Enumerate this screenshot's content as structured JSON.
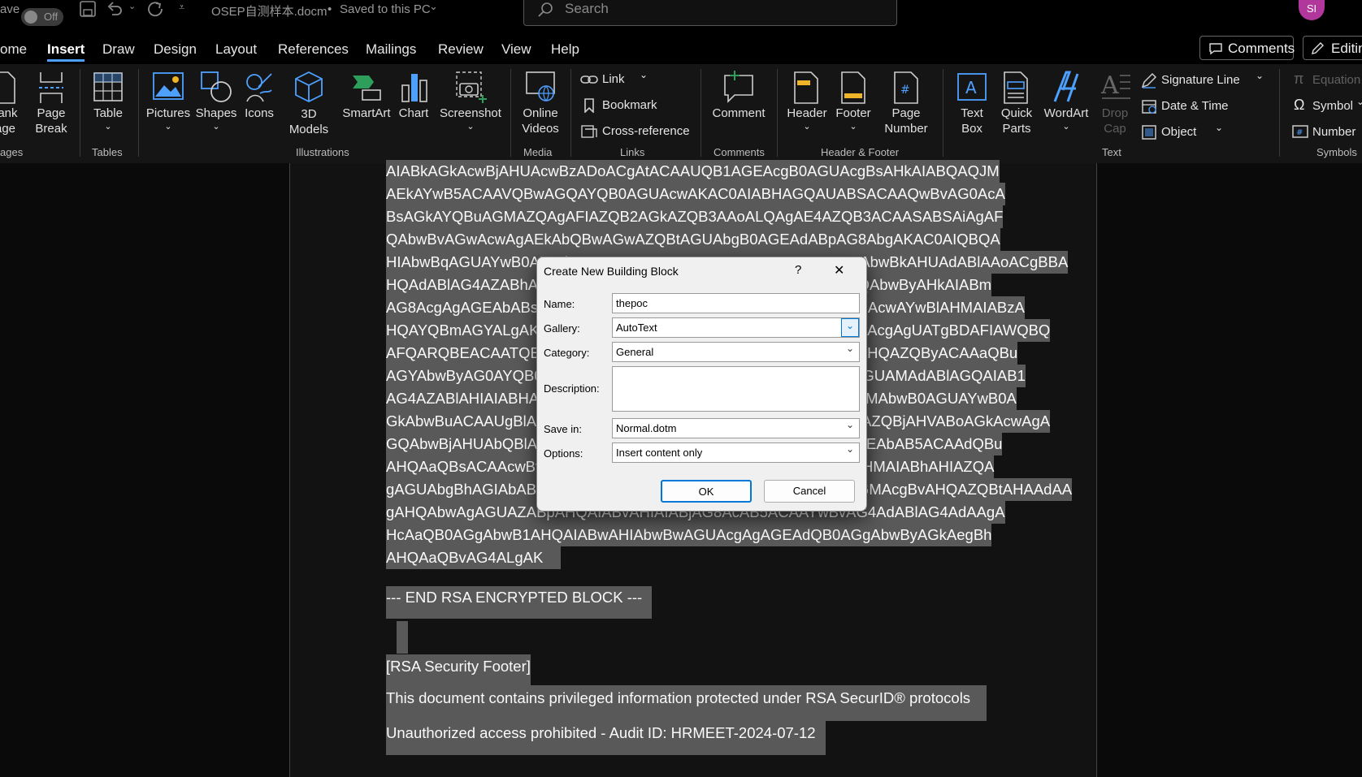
{
  "titlebar": {
    "autosave_label": "ave",
    "autosave_state": "Off",
    "doc_title": "OSEP自测样本.docm",
    "save_status": "Saved to this PC",
    "search_placeholder": "Search",
    "avatar_initials": "SI"
  },
  "menu": {
    "tabs": [
      "ome",
      "Insert",
      "Draw",
      "Design",
      "Layout",
      "References",
      "Mailings",
      "Review",
      "View",
      "Help"
    ],
    "active": "Insert",
    "comments_button": "Comments",
    "editing_button": "Editin"
  },
  "ribbon": {
    "pages": {
      "blank_line1": "lank",
      "blank_line2": "age",
      "break_line1": "Page",
      "break_line2": "Break",
      "group": "ages"
    },
    "tables": {
      "table": "Table",
      "group": "Tables"
    },
    "illustrations": {
      "pictures": "Pictures",
      "shapes": "Shapes",
      "icons": "Icons",
      "models_line1": "3D",
      "models_line2": "Models",
      "smartart": "SmartArt",
      "chart": "Chart",
      "screenshot": "Screenshot",
      "group": "Illustrations"
    },
    "media": {
      "online_line1": "Online",
      "online_line2": "Videos",
      "group": "Media"
    },
    "links": {
      "link": "Link",
      "bookmark": "Bookmark",
      "crossref": "Cross-reference",
      "group": "Links"
    },
    "comments": {
      "comment": "Comment",
      "group": "Comments"
    },
    "header_footer": {
      "header": "Header",
      "footer": "Footer",
      "pagenum_line1": "Page",
      "pagenum_line2": "Number",
      "group": "Header & Footer"
    },
    "text": {
      "textbox_line1": "Text",
      "textbox_line2": "Box",
      "quickparts_line1": "Quick",
      "quickparts_line2": "Parts",
      "wordart": "WordArt",
      "dropcap_line1": "Drop",
      "dropcap_line2": "Cap",
      "signature": "Signature Line",
      "datetime": "Date & Time",
      "object": "Object",
      "group": "Text"
    },
    "symbols": {
      "equation": "Equation",
      "symbol": "Symbol",
      "number": "Number",
      "group": "Symbols"
    }
  },
  "document": {
    "lines": [
      "AIABkAGkAcwBjAHUAcwBzADoACgAtACAAUQB1AGEAcgB0AGUAcgBsAHkAIABQAQJM",
      "AEkAYwB5ACAAVQBwAGQAYQB0AGUAcwAKAC0AIABHAGQAUABSACAAQwBvAG0AcA",
      "BsAGkAYQBuAGMAZQAgAFIAZQB2AGkAZQB3AAoALQAgAE4AZQB3ACAASABSAiAgAF",
      "QAbwBvAGwAcwAgAEkAbQBwAGwAZQBtAGUAbgB0AGEAdABpAG8AbgAKAC0AIQBQA",
      "HIAbwBqAGUAYwB0AHIAbwBqAGUAYwB0AHMAIABpAG4AIABQAHIAbwBkAHUAdABlAAoACgBBA",
      "HQAdABlAG4AZABhAG4AYwBlACAAaQBzACAAbQBhAG4AZABhAHQAbwByAHkAIABm",
      "AG8AcgAgAGEAbABsACAAcwB0AGEAZgBmACAAbQBlAG0AYgBlAHIAcwAYwBlAHMAIABzA",
      "HQAYQBmAGYALgAKAEMAbwBuAHQAYQBjAHQAIABIAFIAIABmAG8AcgAgUATgBDAFIAWQBQ",
      "AFQARQBEACAATQBBAEkATAAgAEIATABPAEMASwAKAEMAbwBuAHQAZQByACAAaQBu",
      "AGYAbwByAG0AYQB0AGkAbwBuACAAaQBzACAAcwBlAGMAdQByAGUAMAdABlAGQAIAB1",
      "AG4AZABlAHIAIABHAEQAUABSACAAcAByAG8AdABvAGMAbwBsAHMAbwB0AGUAYwB0A",
      "GkAbwBuACAAUgBlAGcAdQBsAGEAdABpAG8AbgAgAFAAcgBvAHQAZQBjAHVABoAGkAcwAgA",
      "GQAbwBjAHUAbQBlAG4AdAAgAGMAbwBuAHQAYQBpAG4AcwAgAGEAbAB5ACAAdQBu",
      "AHQAaQBsACAAcwBvAG0AZQAgAHQAaQBtAGUAIABhAG4AZAAgAHMAIABhAHIAZQA",
      "gAGUAbgBhAGIAbABlAGQAIABhAG4AZAAgAHQAaABlACAAbQBhAGMAcgBvAHQAZQBtAHAAdAA",
      "gAHQAbwAgAGUAZABpAHQAIABvAHIAIABjAG8AcAB5ACAAYwBvAG4AdABlAG4AdAAgA",
      "HcAaQB0AGgAbwB1AHQAIABwAHIAbwBwAGUAcgAgAGEAdQB0AGgAbwByAGkAegBh",
      "AHQAaQBvAG4ALgAK"
    ],
    "end_block": "--- END RSA ENCRYPTED BLOCK ---",
    "footer_title": "[RSA Security Footer]",
    "footer_line1": "This document contains privileged information protected under RSA SecurID® protocols",
    "footer_line2": "Unauthorized access prohibited - Audit ID: HRMEET-2024-07-12"
  },
  "dialog": {
    "title": "Create New Building Block",
    "help": "?",
    "close": "✕",
    "name_label": "Name:",
    "name_value": "thepoc",
    "gallery_label": "Gallery:",
    "gallery_value": "AutoText",
    "category_label": "Category:",
    "category_value": "General",
    "description_label": "Description:",
    "description_value": "",
    "savein_label": "Save in:",
    "savein_value": "Normal.dotm",
    "options_label": "Options:",
    "options_value": "Insert content only",
    "ok": "OK",
    "cancel": "Cancel"
  }
}
